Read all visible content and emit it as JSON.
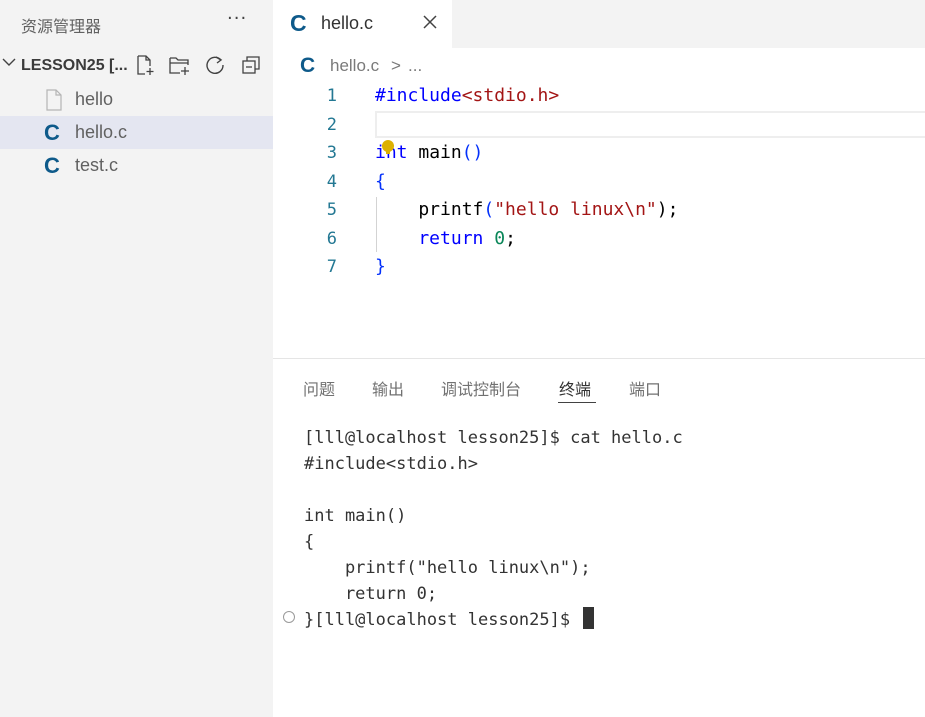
{
  "sidebar": {
    "title": "资源管理器",
    "more": "···",
    "section_label": "LESSON25 [...",
    "files": [
      {
        "name": "hello",
        "icon": "file-icon"
      },
      {
        "name": "hello.c",
        "icon": "c-file-icon",
        "active": true
      },
      {
        "name": "test.c",
        "icon": "c-file-icon"
      }
    ]
  },
  "tab": {
    "icon_text": "C",
    "label": "hello.c"
  },
  "breadcrumb": {
    "icon_text": "C",
    "file": "hello.c",
    "sep": ">",
    "rest": "..."
  },
  "editor": {
    "line_numbers": [
      "1",
      "2",
      "3",
      "4",
      "5",
      "6",
      "7"
    ],
    "lines": [
      [
        {
          "t": "#include",
          "k": "pre"
        },
        {
          "t": "<stdio.h>",
          "k": "inc"
        }
      ],
      [],
      [
        {
          "t": "int",
          "k": "kw"
        },
        {
          "t": " main",
          "k": "fn"
        },
        {
          "t": "()",
          "k": "br"
        }
      ],
      [
        {
          "t": "{",
          "k": "br"
        }
      ],
      [
        {
          "t": "    printf",
          "k": "fn"
        },
        {
          "t": "(",
          "k": "br"
        },
        {
          "t": "\"hello linux\\n\"",
          "k": "str"
        },
        {
          "t": ");",
          "k": "fn"
        }
      ],
      [
        {
          "t": "    return",
          "k": "kw"
        },
        {
          "t": " ",
          "k": "fn"
        },
        {
          "t": "0",
          "k": "num"
        },
        {
          "t": ";",
          "k": "fn"
        }
      ],
      [
        {
          "t": "}",
          "k": "br"
        }
      ]
    ]
  },
  "panel": {
    "tabs": [
      "问题",
      "输出",
      "调试控制台",
      "终端",
      "端口"
    ],
    "active_tab": "终端",
    "terminal_lines": [
      "[lll@localhost lesson25]$ cat hello.c",
      "#include<stdio.h>",
      "",
      "int main()",
      "{",
      "    printf(\"hello linux\\n\");",
      "    return 0;",
      "}[lll@localhost lesson25]$ "
    ]
  },
  "colors": {
    "c_icon": "#0e5a8a",
    "active_item_bg": "#e4e6f1",
    "line_number": "#237893",
    "keyword": "#0000ff",
    "string": "#a31515",
    "number": "#098658"
  }
}
